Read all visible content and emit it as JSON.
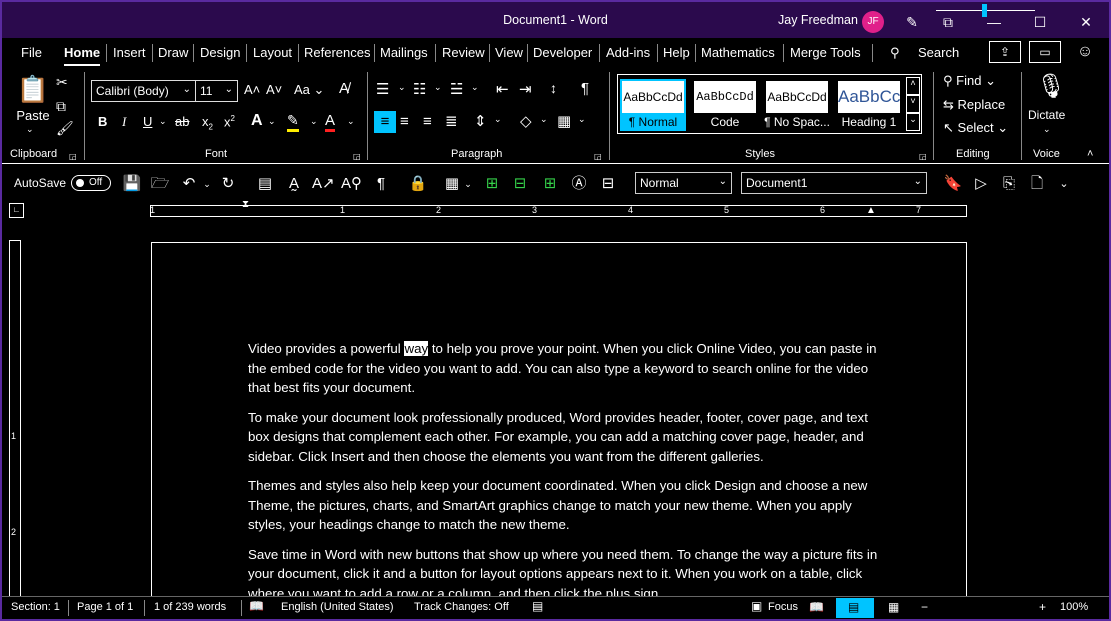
{
  "window": {
    "title": "Document1  -  Word",
    "user_name": "Jay Freedman",
    "user_initials": "JF",
    "icons": [
      "pen-icon",
      "restore-display-icon",
      "minimize-icon",
      "maximize-icon",
      "close-icon"
    ]
  },
  "tabs": [
    {
      "label": "File"
    },
    {
      "label": "Home",
      "active": true
    },
    {
      "label": "Insert"
    },
    {
      "label": "Draw"
    },
    {
      "label": "Design"
    },
    {
      "label": "Layout"
    },
    {
      "label": "References"
    },
    {
      "label": "Mailings"
    },
    {
      "label": "Review"
    },
    {
      "label": "View"
    },
    {
      "label": "Developer"
    },
    {
      "label": "Add-ins"
    },
    {
      "label": "Help"
    },
    {
      "label": "Mathematics"
    },
    {
      "label": "Merge Tools"
    }
  ],
  "search_label": "Search",
  "ribbon": {
    "clipboard": {
      "paste": "Paste",
      "group": "Clipboard"
    },
    "font": {
      "name": "Calibri (Body)",
      "size": "11",
      "group": "Font",
      "change_case": "Aa"
    },
    "paragraph": {
      "group": "Paragraph"
    },
    "styles": {
      "group": "Styles",
      "items": [
        {
          "preview": "AaBbCcDd",
          "name": "¶ Normal",
          "selected": true
        },
        {
          "preview": "AaBbCcDd",
          "name": "Code"
        },
        {
          "preview": "AaBbCcDd",
          "name": "¶ No Spac..."
        },
        {
          "preview": "AaBbCc",
          "name": "Heading 1"
        }
      ]
    },
    "editing": {
      "find": "Find",
      "replace": "Replace",
      "select": "Select",
      "group": "Editing"
    },
    "voice": {
      "dictate": "Dictate",
      "group": "Voice"
    }
  },
  "qat": {
    "autosave_label": "AutoSave",
    "autosave_state": "Off",
    "style_select": "Normal",
    "document_select": "Document1"
  },
  "ruler": {
    "h_numbers": [
      "1",
      "1",
      "2",
      "3",
      "4",
      "5",
      "6",
      "7"
    ],
    "v_numbers": [
      "1",
      "2"
    ]
  },
  "document": {
    "paragraphs": [
      {
        "before": "Video provides a powerful ",
        "highlight": "way",
        "after": " to help you prove your point. When you click Online Video, you can paste in the embed code for the video you want to add. You can also type a keyword to search online for the video that best fits your document."
      },
      {
        "text": "To make your document look professionally produced, Word provides header, footer, cover page, and text box designs that complement each other. For example, you can add a matching cover page, header, and sidebar. Click Insert and then choose the elements you want from the different galleries."
      },
      {
        "text": "Themes and styles also help keep your document coordinated. When you click Design and choose a new Theme, the pictures, charts, and SmartArt graphics change to match your new theme. When you apply styles, your headings change to match the new theme."
      },
      {
        "text": "Save time in Word with new buttons that show up where you need them. To change the way a picture fits in your document, click it and a button for layout options appears next to it. When you work on a table, click where you want to add a row or a column, and then click the plus sign."
      }
    ]
  },
  "status": {
    "section": "Section: 1",
    "page": "Page 1 of 1",
    "words": "1 of 239 words",
    "language": "English (United States)",
    "track_changes": "Track Changes: Off",
    "focus": "Focus",
    "zoom": "100%",
    "zoom_minus": "−",
    "zoom_plus": "+"
  },
  "colors": {
    "titlebar": "#2b0a4d",
    "accent": "#00c4ff",
    "avatar": "#e0208a",
    "green_icon": "#35d04a"
  }
}
